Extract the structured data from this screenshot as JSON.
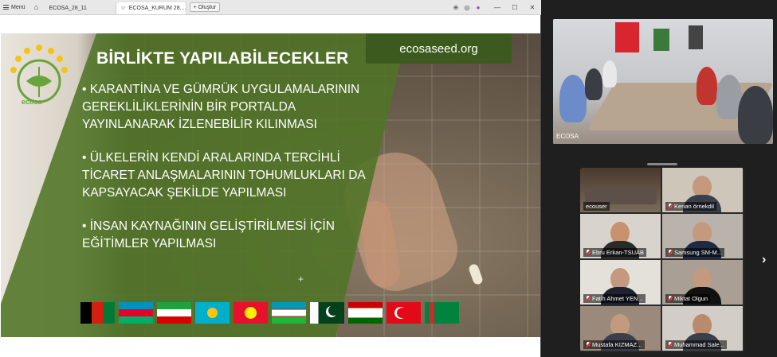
{
  "browser": {
    "menu_label": "Menü",
    "tabs": [
      {
        "label": "ECOSA_28_11"
      },
      {
        "label": "ECOSA_KURUM 28...."
      }
    ],
    "new_tab_label": "Oluştur"
  },
  "slide": {
    "title": "BİRLİKTE YAPILABİLECEKLER",
    "website": "ecosaseed.org",
    "logo_text": "ecosa",
    "bullets": [
      "• KARANTİNA VE GÜMRÜK UYGULAMALARININ GEREKLİLİKLERİNİN BİR PORTALDA YAYINLANARAK İZLENEBİLİR KILINMASI",
      "• ÜLKELERİN KENDİ ARALARINDA TERCİHLİ TİCARET ANLAŞMALARININ  TOHUMLUKLARI DA KAPSAYACAK ŞEKİLDE YAPILMASI",
      "• İNSAN KAYNAĞININ GELİŞTİRİLMESİ İÇİN EĞİTİMLER YAPILMASI"
    ],
    "flags": [
      {
        "icon": "afghanistan-flag"
      },
      {
        "icon": "azerbaijan-flag"
      },
      {
        "icon": "iran-flag"
      },
      {
        "icon": "kazakhstan-flag"
      },
      {
        "icon": "kyrgyzstan-flag"
      },
      {
        "icon": "uzbekistan-flag"
      },
      {
        "icon": "pakistan-flag"
      },
      {
        "icon": "tajikistan-flag"
      },
      {
        "icon": "turkey-flag"
      },
      {
        "icon": "turkmenistan-flag"
      }
    ]
  },
  "meeting": {
    "main_label": "ECOSA",
    "participants": [
      {
        "name": "ecouser",
        "muted": false
      },
      {
        "name": "Kenan örnekdil",
        "muted": true
      },
      {
        "name": "Ebru Erkan-TSUAB",
        "muted": true
      },
      {
        "name": "Samsung SM-M...",
        "muted": true
      },
      {
        "name": "Fatih Ahmet YEN...",
        "muted": true
      },
      {
        "name": "Miktat Olgun",
        "muted": true
      },
      {
        "name": "Mustafa KIZMAZ...",
        "muted": true
      },
      {
        "name": "Muhammad Sale...",
        "muted": true
      }
    ]
  },
  "colors": {
    "slide_green": "#507426",
    "header_green": "#3d5a1e",
    "background": "#1f1f1f"
  }
}
